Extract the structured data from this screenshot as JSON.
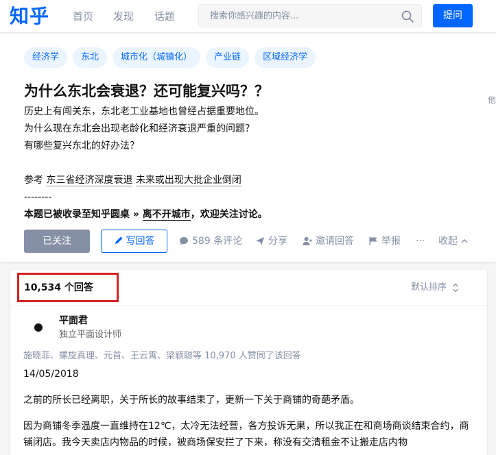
{
  "header": {
    "logo": "知乎",
    "nav": [
      "首页",
      "发现",
      "话题"
    ],
    "search_placeholder": "搜索你感兴趣的内容...",
    "ask_label": "提问"
  },
  "question": {
    "tags": [
      "经济学",
      "东北",
      "城市化（城镇化）",
      "产业链",
      "区域经济学"
    ],
    "side_glyph": "他",
    "title": "为什么东北会衰退？还可能复兴吗？？",
    "desc_lines": [
      "历史上有闯关东，东北老工业基地也曾经占据重要地位。",
      "为什么现在东北会出现老龄化和经济衰退严重的问题？",
      "有哪些复兴东北的好办法？"
    ],
    "ref_prefix": "参考",
    "ref_link_1": "东三省经济深度衰退",
    "ref_link_2": "未来或出现大批企业倒闭",
    "divider": "--------",
    "roundtable_prefix": "本题已被收录至知乎圆桌 »",
    "roundtable_name": "离不开城市",
    "roundtable_suffix": "，欢迎关注讨论。",
    "actions": {
      "followed": "已关注",
      "write_answer": "写回答",
      "comments": "589 条评论",
      "share": "分享",
      "invite": "邀请回答",
      "report": "举报",
      "more": "···",
      "collapse": "收起"
    }
  },
  "answers": {
    "count_label": "10,534 个回答",
    "sort_label": "默认排序",
    "first": {
      "author": "平面君",
      "bio": "独立平面设计师",
      "voters": "施晓菲、螺旋真理、元首、王云霄、梁颖聪等 10,970 人赞同了该回答",
      "date": "14/05/2018",
      "para1": "之前的所长已经离职，关于所长的故事结束了，更新一下关于商铺的奇葩矛盾。",
      "para2": "因为商铺冬季温度一直维持在12℃，太冷无法经营，各方投诉无果，所以我正在和商场商谈结束合约，商铺闭店。我今天卖店内物品的时候，被商场保安拦了下来，称没有交清租金不让搬走店内物"
    }
  },
  "colors": {
    "brand": "#0066ff",
    "highlight_box": "#d42020"
  }
}
